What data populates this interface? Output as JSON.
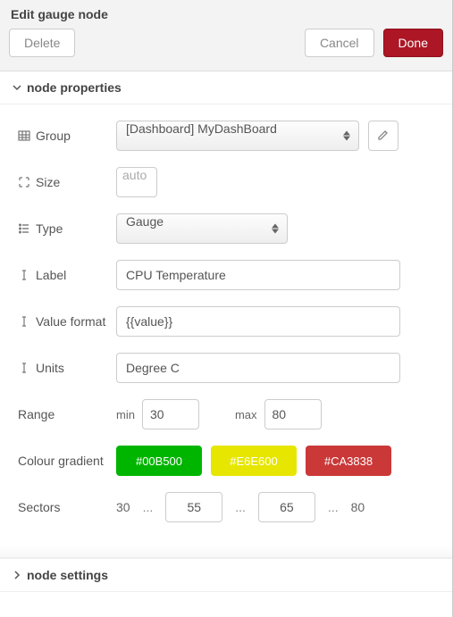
{
  "header": {
    "title": "Edit gauge node",
    "delete": "Delete",
    "cancel": "Cancel",
    "done": "Done"
  },
  "sections": {
    "properties": "node properties",
    "settings": "node settings"
  },
  "labels": {
    "group": "Group",
    "size": "Size",
    "type": "Type",
    "label": "Label",
    "value_format": "Value format",
    "units": "Units",
    "range": "Range",
    "min": "min",
    "max": "max",
    "colour_gradient": "Colour gradient",
    "sectors": "Sectors"
  },
  "values": {
    "group": "[Dashboard] MyDashBoard",
    "size": "auto",
    "type": "Gauge",
    "label": "CPU Temperature",
    "value_format": "{{value}}",
    "units": "Degree C",
    "range_min": "30",
    "range_max": "80",
    "sector_low": "30",
    "sector_mid1": "55",
    "sector_mid2": "65",
    "sector_high": "80"
  },
  "colors": {
    "grad1": "#00B500",
    "grad2": "#E6E600",
    "grad3": "#CA3838"
  },
  "icons": {
    "group": "table-icon",
    "size": "arrows-out-icon",
    "type": "list-icon",
    "label": "i-cursor-icon",
    "value_format": "i-cursor-icon",
    "units": "i-cursor-icon",
    "edit": "pencil-icon",
    "chev_down": "chevron-down-icon",
    "chev_right": "chevron-right-icon"
  }
}
